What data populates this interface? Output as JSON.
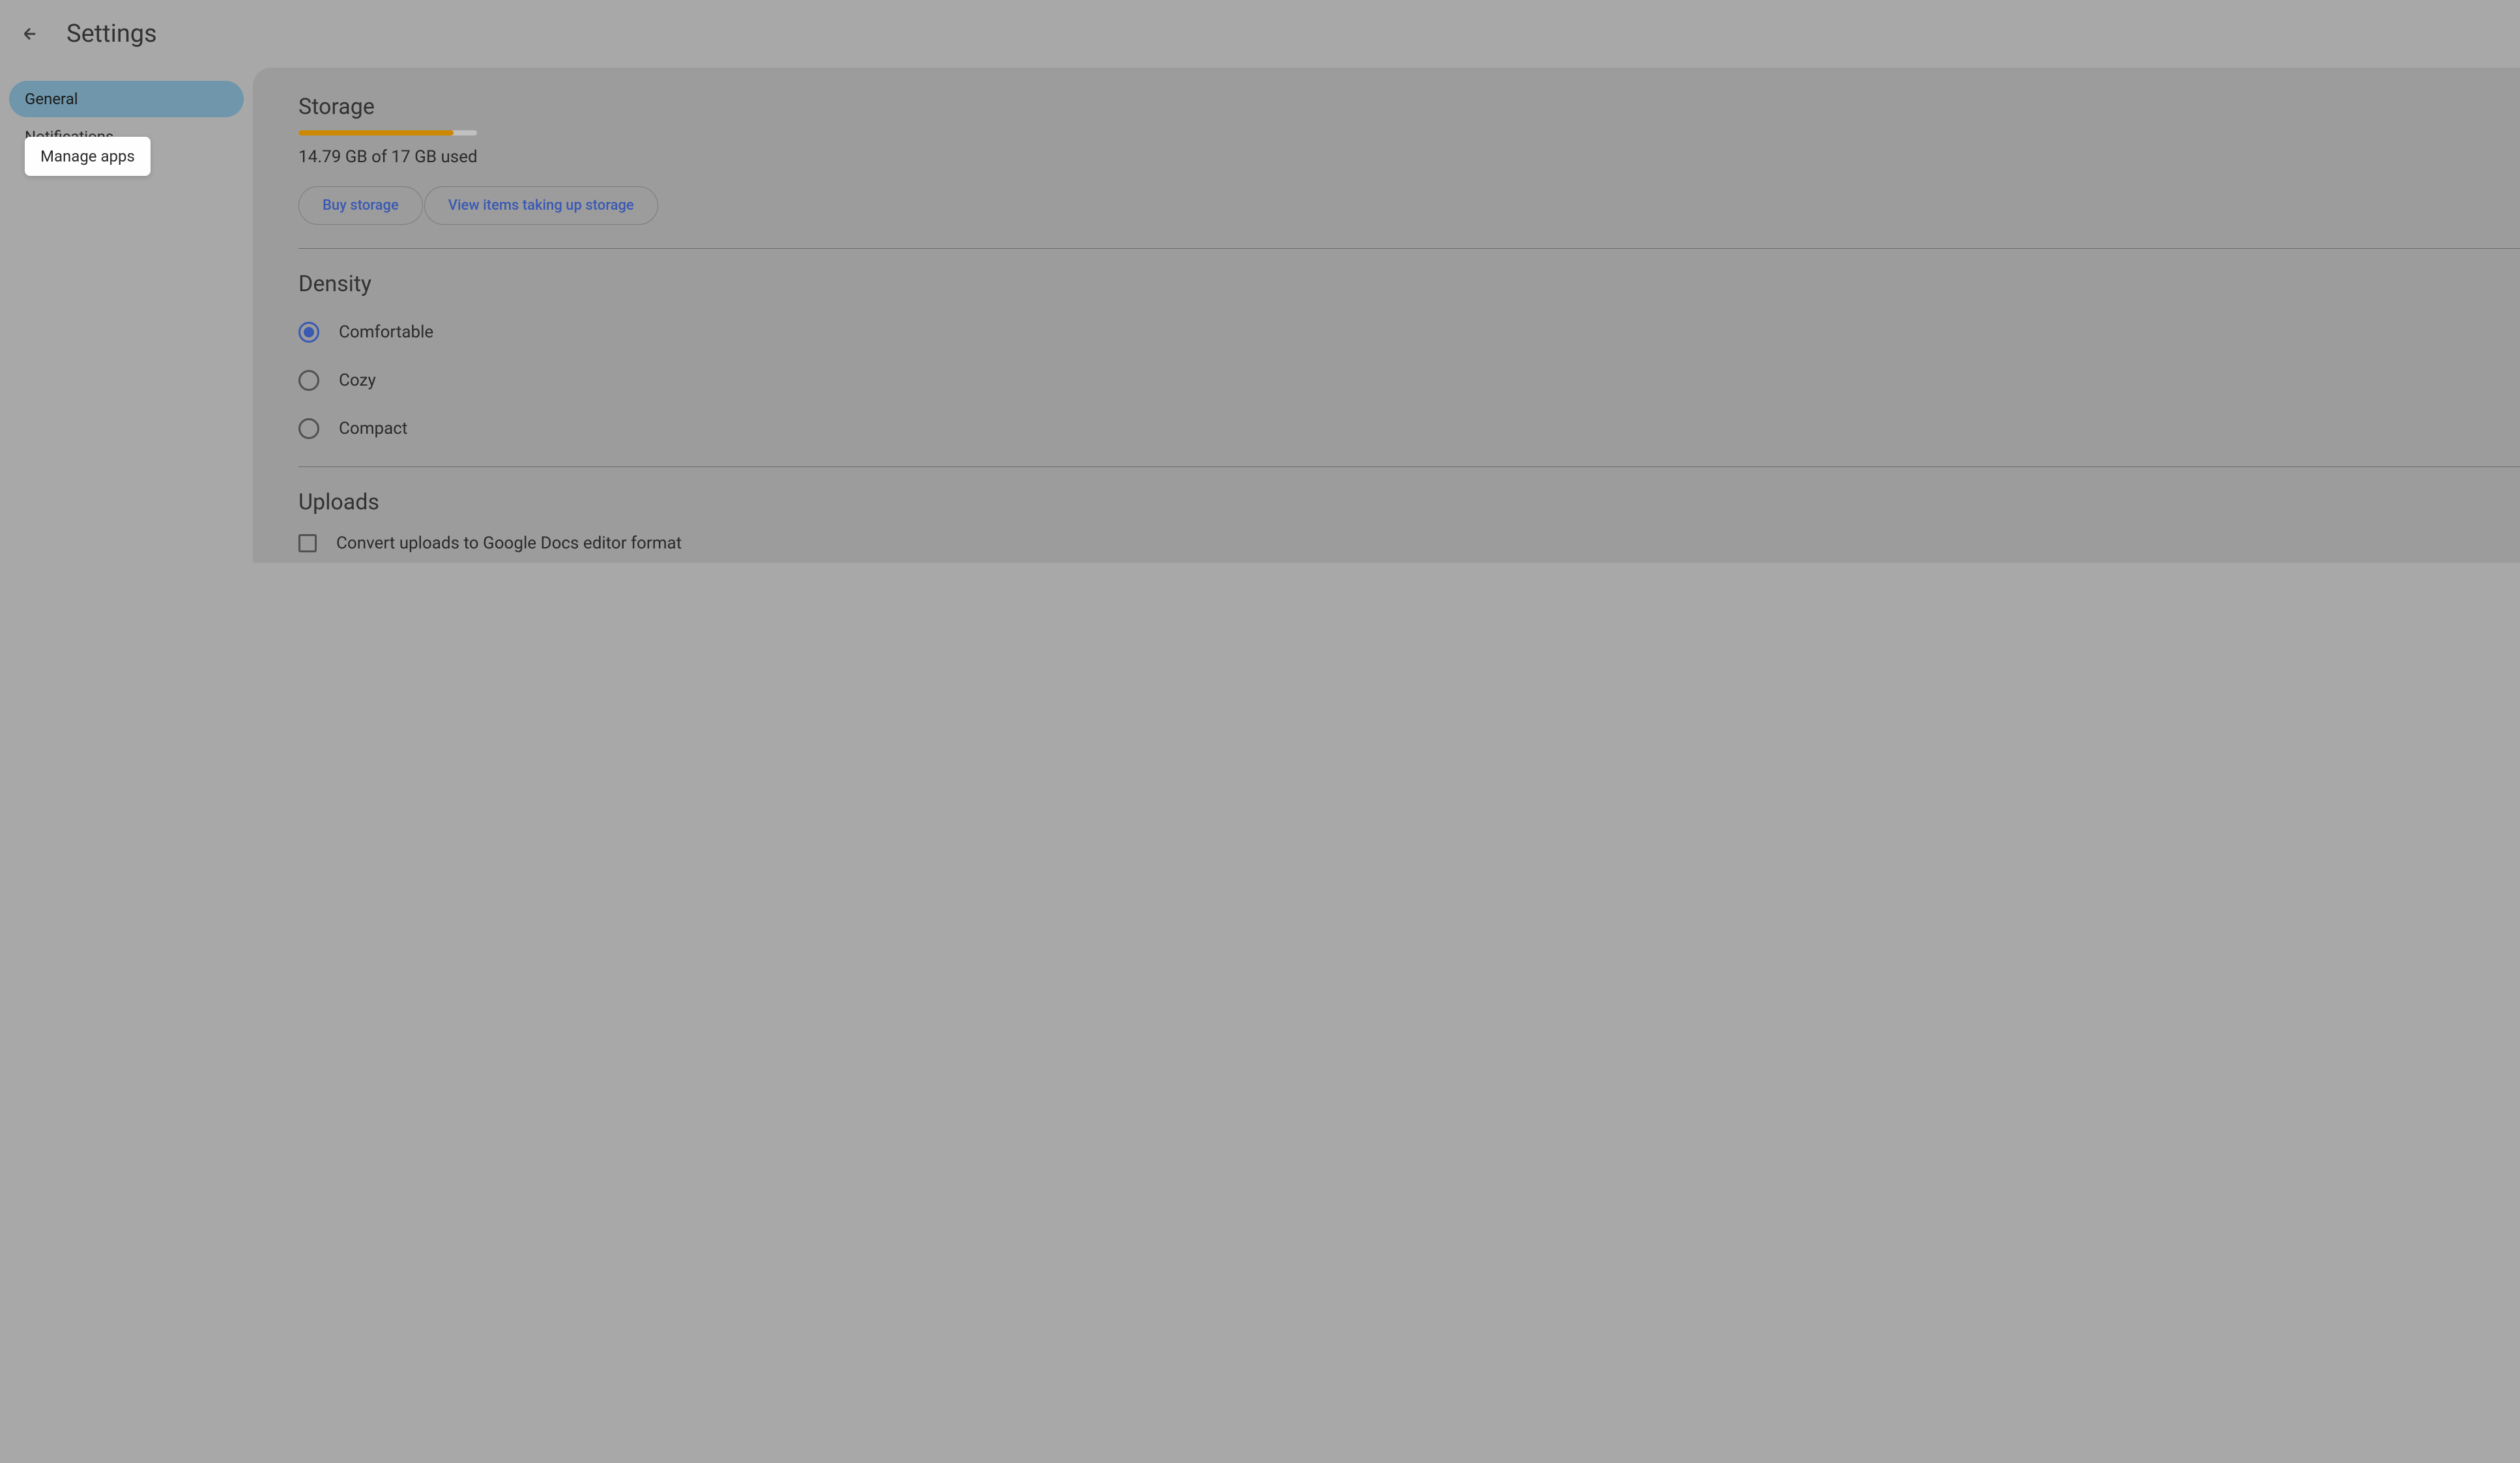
{
  "header": {
    "title": "Settings"
  },
  "sidebar": {
    "items": [
      {
        "label": "General",
        "active": true
      },
      {
        "label": "Notifications",
        "active": false
      }
    ]
  },
  "tooltip": {
    "text": "Manage apps"
  },
  "storage": {
    "section_title": "Storage",
    "usage_text": "14.79 GB of 17 GB used",
    "progress_percent": 87,
    "buy_button": "Buy storage",
    "view_button": "View items taking up storage"
  },
  "density": {
    "section_title": "Density",
    "options": [
      {
        "label": "Comfortable",
        "selected": true
      },
      {
        "label": "Cozy",
        "selected": false
      },
      {
        "label": "Compact",
        "selected": false
      }
    ]
  },
  "uploads": {
    "section_title": "Uploads",
    "convert_label": "Convert uploads to Google Docs editor format",
    "convert_checked": false
  }
}
